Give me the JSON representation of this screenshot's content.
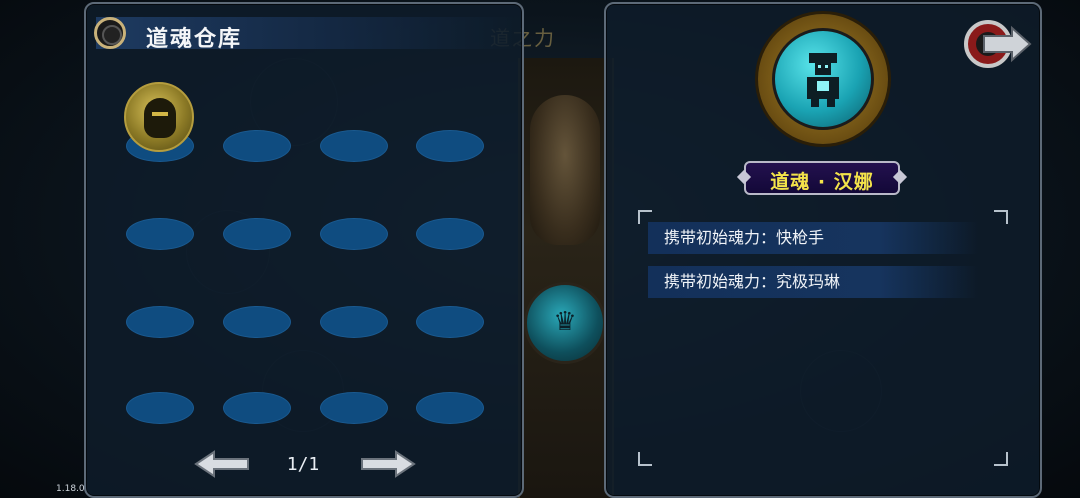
{
  "background": {
    "title": "道之力"
  },
  "version": "1.18.0",
  "warehouse": {
    "title": "道魂仓库",
    "page_indicator": "1/1"
  },
  "detail": {
    "soul_name": "道魂 · 汉娜",
    "attributes": [
      {
        "text": "携带初始魂力：快枪手"
      },
      {
        "text": "携带初始魂力：究极玛琳"
      }
    ]
  },
  "colors": {
    "slot_fill": "#0f4c80",
    "name_text": "#f3e34a",
    "panel_border": "#5d6a78",
    "portrait_teal": "#1aa3b3",
    "gold_ring": "#a9852a"
  },
  "icons": {
    "prev_page": "left-arrow-icon",
    "next_page": "right-arrow-icon",
    "return": "return-arrow-icon",
    "title_emblem": "ring-emblem-icon"
  }
}
